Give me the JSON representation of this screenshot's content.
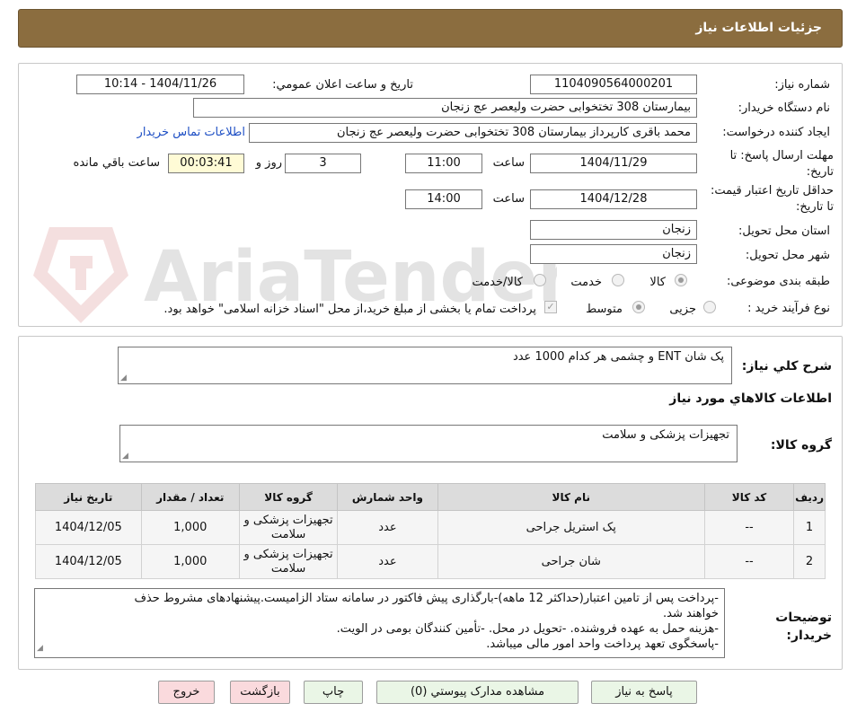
{
  "header": {
    "title": "جزئیات اطلاعات نیاز"
  },
  "form": {
    "need_number": {
      "label": "شماره نیاز:",
      "value": "1104090564000201"
    },
    "announce_datetime": {
      "label": "تاریخ و ساعت اعلان عمومي:",
      "value": "1404/11/26 - 10:14"
    },
    "buyer_org": {
      "label": "نام دستگاه خریدار:",
      "value": "بیمارستان 308 تختخوابی حضرت ولیعصر عج  زنجان"
    },
    "requester": {
      "label": "ایجاد کننده درخواست:",
      "value": "محمد باقری کارپرداز بیمارستان 308 تختخوابی حضرت ولیعصر عج  زنجان",
      "contact_link": "اطلاعات تماس خریدار"
    },
    "reply_deadline": {
      "label": "مهلت ارسال پاسخ: تا تاریخ:",
      "date": "1404/11/29",
      "time_label": "ساعت",
      "time": "11:00",
      "days": "3",
      "days_label": "روز و",
      "remaining": "00:03:41",
      "remaining_label": "ساعت باقي مانده"
    },
    "price_validity": {
      "label": "حداقل تاریخ اعتبار قیمت: تا تاریخ:",
      "date": "1404/12/28",
      "time_label": "ساعت",
      "time": "14:00"
    },
    "province": {
      "label": "استان محل تحویل:",
      "value": "زنجان"
    },
    "city": {
      "label": "شهر محل تحویل:",
      "value": "زنجان"
    },
    "category": {
      "label": "طبقه بندی موضوعی:",
      "options": [
        "کالا",
        "خدمت",
        "کالا/خدمت"
      ],
      "selected": "کالا"
    },
    "process_type": {
      "label": "نوع فرآیند خرید :",
      "options": [
        "جزیی",
        "متوسط"
      ],
      "selected": "متوسط",
      "note": "پرداخت تمام یا بخشی از مبلغ خرید،از محل \"اسناد خزانه اسلامی\" خواهد بود."
    }
  },
  "summary": {
    "label": "شرح کلي نیاز:",
    "value": "پک شان ENT و چشمی هر کدام 1000 عدد",
    "goods_info_title": "اطلاعات کالاهاي مورد نياز",
    "group_label": "گروه کالا:",
    "group_value": "تجهیزات پزشکی و سلامت"
  },
  "table": {
    "headers": [
      "رديف",
      "کد کالا",
      "نام کالا",
      "واحد شمارش",
      "گروه کالا",
      "تعداد / مقدار",
      "تاريخ نياز"
    ],
    "rows": [
      [
        "1",
        "--",
        "پک استریل جراحی",
        "عدد",
        "تجهیزات پزشکی و سلامت",
        "1,000",
        "1404/12/05"
      ],
      [
        "2",
        "--",
        "شان جراحی",
        "عدد",
        "تجهیزات پزشکی و سلامت",
        "1,000",
        "1404/12/05"
      ]
    ]
  },
  "notes": {
    "label": "توضیحات خریدار:",
    "lines": [
      "-پرداخت پس از تامین اعتبار(حداکثر 12 ماهه)-بارگذاری پیش فاکتور در سامانه ستاد الزامیست.پیشنهادهای مشروط حذف",
      "خواهند شد.",
      "-هزینه حمل به عهده فروشنده. -تحویل در محل. -تأمین کنندگان بومی در الویت.",
      "-پاسخگوی تعهد پرداخت واحد امور مالی میباشد."
    ]
  },
  "buttons": {
    "reply": "پاسخ به نياز",
    "attachments": "مشاهده مدارک پيوستي (0)",
    "print": "چاپ",
    "back": "بازگشت",
    "exit": "خروج"
  },
  "watermark": {
    "text": "AriaTender.neT"
  },
  "colors": {
    "header_bg": "#8b6d3f",
    "timer_bg": "#fffbd6",
    "link": "#1e4fc4",
    "button_green": "#eaf6e6",
    "button_pink": "#fadadd"
  }
}
